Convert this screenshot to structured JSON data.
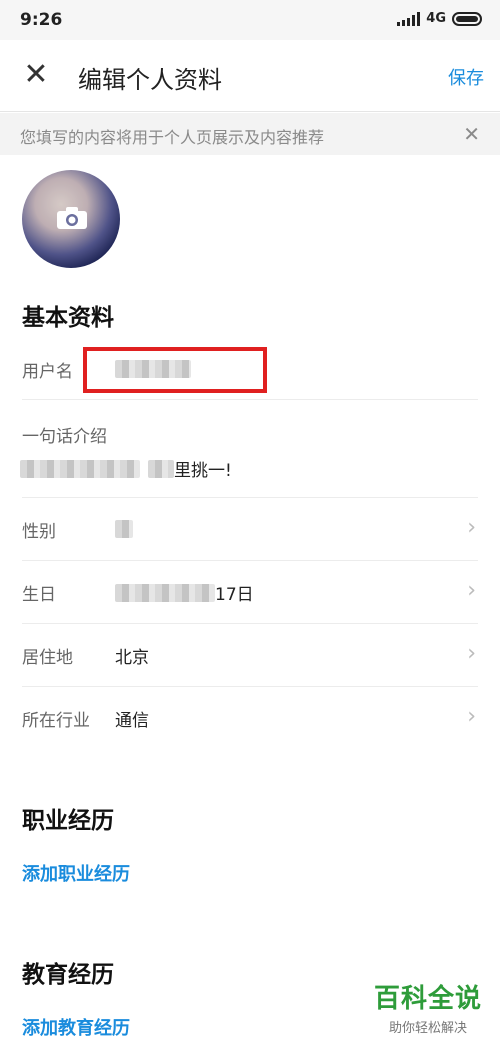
{
  "status": {
    "time": "9:26",
    "network": "4G"
  },
  "header": {
    "title": "编辑个人资料",
    "save": "保存"
  },
  "notice": {
    "text": "您填写的内容将用于个人页展示及内容推荐"
  },
  "basic": {
    "title": "基本资料",
    "username_label": "用户名",
    "intro_label": "一句话介绍",
    "intro_suffix": "里挑一!",
    "gender_label": "性别",
    "birthday_label": "生日",
    "birthday_suffix": "17日",
    "location_label": "居住地",
    "location_value": "北京",
    "industry_label": "所在行业",
    "industry_value": "通信"
  },
  "career": {
    "title": "职业经历",
    "add": "添加职业经历"
  },
  "education": {
    "title": "教育经历",
    "add": "添加教育经历"
  },
  "watermark": {
    "title": "百科全说",
    "subtitle": "助你轻松解决"
  },
  "colors": {
    "accent": "#1a8cdd",
    "highlight": "#e02020",
    "watermark": "#2e9c3a"
  }
}
